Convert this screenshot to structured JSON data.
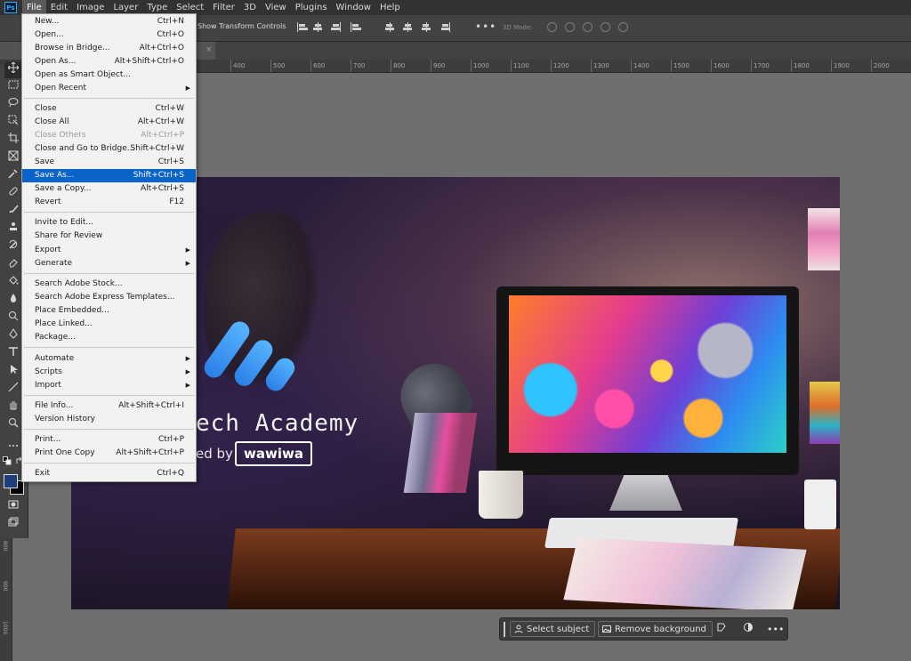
{
  "app": {
    "logo_text": "Ps"
  },
  "menubar": [
    "File",
    "Edit",
    "Image",
    "Layer",
    "Type",
    "Select",
    "Filter",
    "3D",
    "View",
    "Plugins",
    "Window",
    "Help"
  ],
  "options_bar": {
    "transform_label": "Show Transform Controls",
    "more": "•••",
    "mode_label": "3D Mode:"
  },
  "tab": {
    "close": "×"
  },
  "ruler_h": [
    "400",
    "500",
    "600",
    "700",
    "800",
    "900",
    "1000",
    "1100",
    "1200",
    "1300",
    "1400",
    "1500",
    "1600",
    "1700",
    "1800",
    "1900",
    "2000"
  ],
  "ruler_v": [
    "800",
    "900",
    "1000",
    "1100"
  ],
  "file_menu": {
    "items": [
      {
        "label": "New...",
        "shortcut": "Ctrl+N"
      },
      {
        "label": "Open...",
        "shortcut": "Ctrl+O"
      },
      {
        "label": "Browse in Bridge...",
        "shortcut": "Alt+Ctrl+O"
      },
      {
        "label": "Open As...",
        "shortcut": "Alt+Shift+Ctrl+O"
      },
      {
        "label": "Open as Smart Object...",
        "shortcut": ""
      },
      {
        "label": "Open Recent",
        "shortcut": "",
        "submenu": true
      },
      {
        "label": "Close",
        "shortcut": "Ctrl+W"
      },
      {
        "label": "Close All",
        "shortcut": "Alt+Ctrl+W"
      },
      {
        "label": "Close Others",
        "shortcut": "Alt+Ctrl+P",
        "disabled": true
      },
      {
        "label": "Close and Go to Bridge...",
        "shortcut": "Shift+Ctrl+W"
      },
      {
        "label": "Save",
        "shortcut": "Ctrl+S"
      },
      {
        "label": "Save As...",
        "shortcut": "Shift+Ctrl+S",
        "highlighted": true
      },
      {
        "label": "Save a Copy...",
        "shortcut": "Alt+Ctrl+S"
      },
      {
        "label": "Revert",
        "shortcut": "F12"
      },
      {
        "label": "Invite to Edit...",
        "shortcut": ""
      },
      {
        "label": "Share for Review",
        "shortcut": ""
      },
      {
        "label": "Export",
        "shortcut": "",
        "submenu": true
      },
      {
        "label": "Generate",
        "shortcut": "",
        "submenu": true
      },
      {
        "label": "Search Adobe Stock...",
        "shortcut": ""
      },
      {
        "label": "Search Adobe Express Templates...",
        "shortcut": ""
      },
      {
        "label": "Place Embedded...",
        "shortcut": ""
      },
      {
        "label": "Place Linked...",
        "shortcut": ""
      },
      {
        "label": "Package...",
        "shortcut": ""
      },
      {
        "label": "Automate",
        "shortcut": "",
        "submenu": true
      },
      {
        "label": "Scripts",
        "shortcut": "",
        "submenu": true
      },
      {
        "label": "Import",
        "shortcut": "",
        "submenu": true
      },
      {
        "label": "File Info...",
        "shortcut": "Alt+Shift+Ctrl+I"
      },
      {
        "label": "Version History",
        "shortcut": ""
      },
      {
        "label": "Print...",
        "shortcut": "Ctrl+P"
      },
      {
        "label": "Print One Copy",
        "shortcut": "Alt+Shift+Ctrl+P"
      },
      {
        "label": "Exit",
        "shortcut": "Ctrl+Q"
      }
    ]
  },
  "canvas": {
    "brand_title": "ech Academy",
    "brand_by": "ed by",
    "brand_logo": "wawiwa",
    "logo_color": "#3a95f5"
  },
  "context_bar": {
    "select_subject": "Select subject",
    "remove_background": "Remove background",
    "more": "•••"
  },
  "toolbar": {
    "fg_color": "#1f3f7c",
    "bg_color": "#000000"
  },
  "colors": {
    "menu_highlight": "#0a63c9",
    "panel": "#424242",
    "workspace": "#6e6f6e"
  }
}
